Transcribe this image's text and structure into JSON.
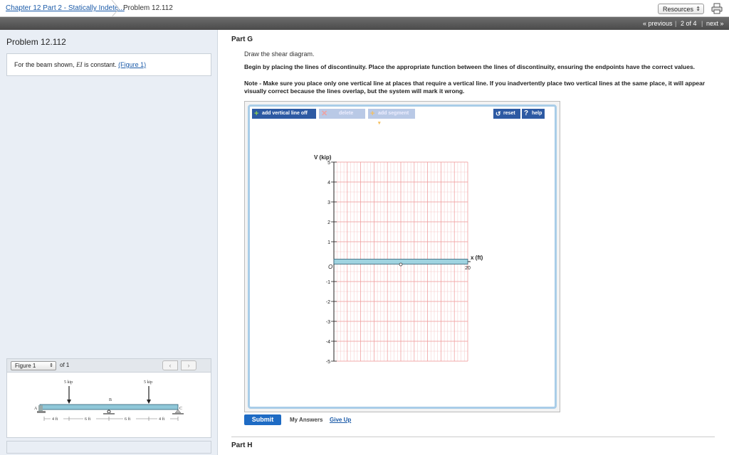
{
  "topbar": {
    "breadcrumb_link": "Chapter 12 Part 2 - Statically Indete...",
    "breadcrumb_current": "Problem 12.112",
    "resources_label": "Resources"
  },
  "nav": {
    "previous": "« previous",
    "position": "2 of 4",
    "next": "next »"
  },
  "left": {
    "title": "Problem 12.112",
    "prompt_prefix": "For the beam shown,",
    "prompt_var": "EI",
    "prompt_mid": "is constant.",
    "figure_link": "(Figure 1)",
    "figure_select": "Figure 1",
    "figure_of": "of 1",
    "figure": {
      "load_left": "5 kip",
      "load_right": "5 kip",
      "label_a": "A",
      "label_b": "B",
      "label_c": "C",
      "dims": [
        "4 ft",
        "6 ft",
        "6 ft",
        "4 ft"
      ]
    }
  },
  "part": {
    "title": "Part G",
    "instruction": "Draw the shear diagram.",
    "begin": "Begin by placing the lines of discontinuity. Place the appropriate function between the lines of discontinuity, ensuring the endpoints have the correct values.",
    "note": "Note - Make sure you place only one vertical line at places that require a vertical line. If you inadvertently place two vertical lines at the same place, it will appear visually correct because the lines overlap, but the system will mark it wrong."
  },
  "toolbar": {
    "add_vertical": "add vertical line off",
    "delete": "delete",
    "add_segment": "add segment",
    "reset": "reset",
    "help": "help"
  },
  "chart_data": {
    "type": "line",
    "ylabel": "V (kip)",
    "xlabel": "x (ft)",
    "xlim": [
      0,
      20
    ],
    "ylim": [
      -5,
      5
    ],
    "x_ticks": [
      "20"
    ],
    "y_ticks": [
      "5",
      "4",
      "3",
      "2",
      "1",
      "-1",
      "-2",
      "-3",
      "-4",
      "-5"
    ],
    "origin_label": "O",
    "grid": true,
    "beam_overlay": true
  },
  "actions": {
    "submit": "Submit",
    "my_answers": "My Answers",
    "give_up": "Give Up"
  },
  "next_part": "Part H"
}
